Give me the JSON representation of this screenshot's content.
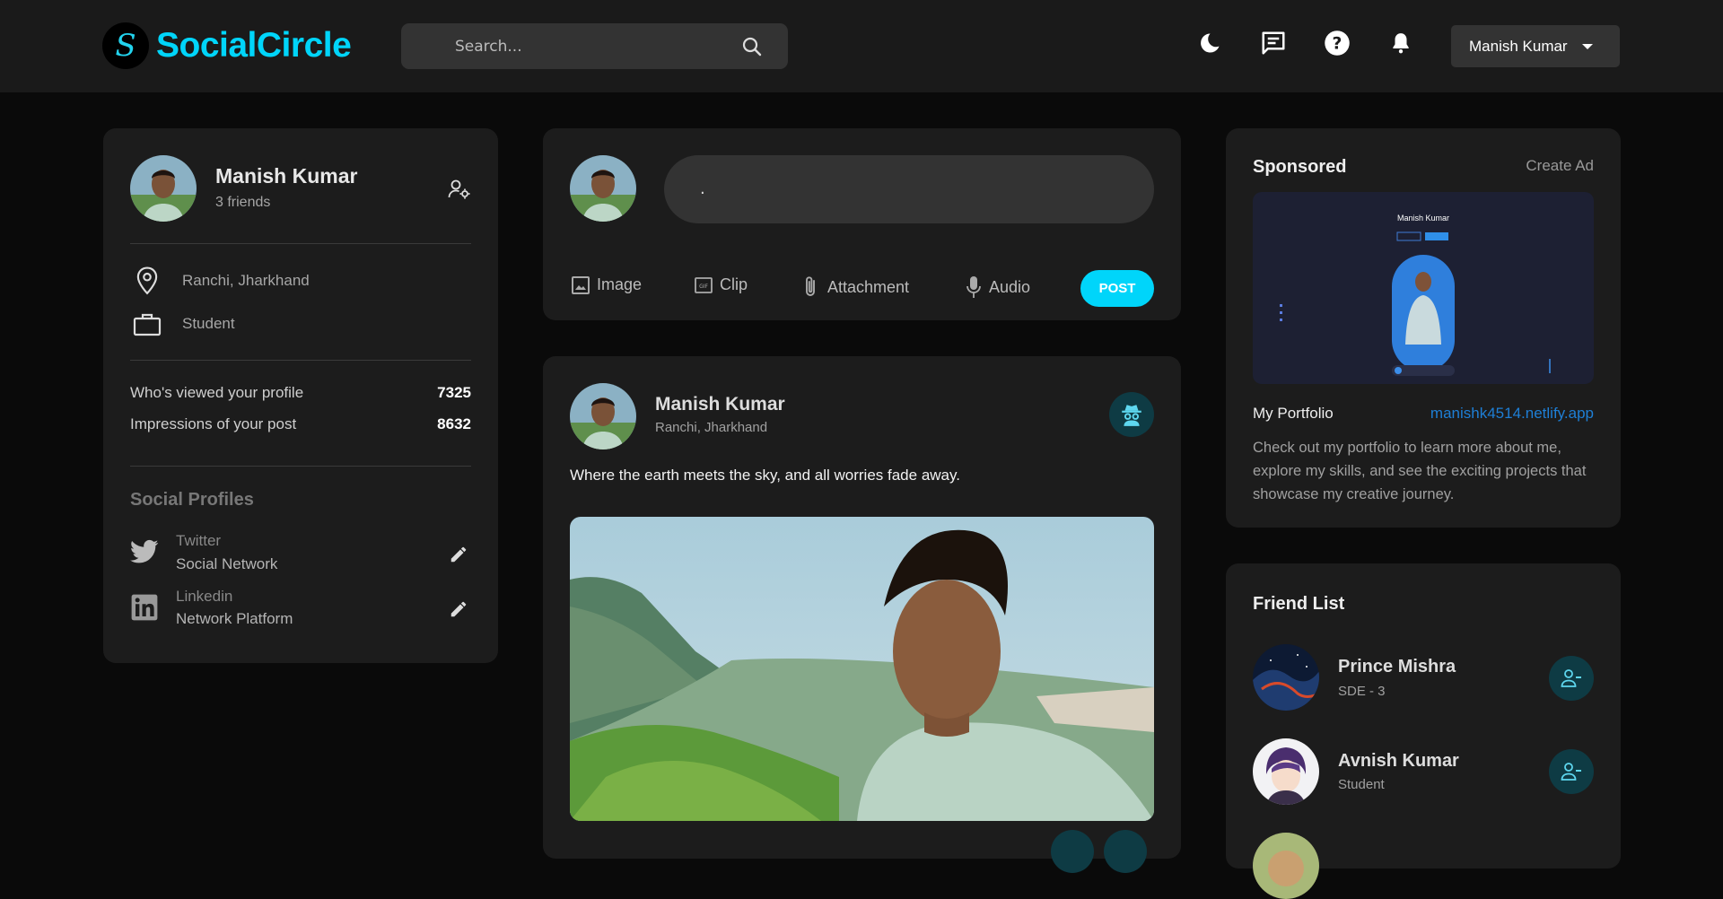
{
  "app": {
    "brand": "SocialCircle",
    "logo_letter": "S",
    "accent": "#00d5fa"
  },
  "navbar": {
    "search_placeholder": "Search...",
    "icons": [
      "moon-icon",
      "message-icon",
      "help-icon",
      "bell-icon"
    ],
    "user_name": "Manish Kumar"
  },
  "profile": {
    "name": "Manish Kumar",
    "friends": "3 friends",
    "location": "Ranchi, Jharkhand",
    "occupation": "Student",
    "stats": [
      {
        "label": "Who's viewed your profile",
        "value": "7325"
      },
      {
        "label": "Impressions of your post",
        "value": "8632"
      }
    ],
    "social_title": "Social Profiles",
    "social": [
      {
        "name": "Twitter",
        "sub": "Social Network",
        "icon": "twitter-icon"
      },
      {
        "name": "Linkedin",
        "sub": "Network Platform",
        "icon": "linkedin-icon"
      }
    ]
  },
  "composer": {
    "value": ".",
    "actions": [
      {
        "label": "Image",
        "icon": "image-icon"
      },
      {
        "label": "Clip",
        "icon": "gif-icon"
      },
      {
        "label": "Attachment",
        "icon": "paperclip-icon"
      },
      {
        "label": "Audio",
        "icon": "microphone-icon"
      }
    ],
    "post_label": "POST"
  },
  "post": {
    "author": "Manish Kumar",
    "location": "Ranchi, Jharkhand",
    "text": "Where the earth meets the sky, and all worries fade away."
  },
  "sponsored": {
    "title": "Sponsored",
    "create_ad": "Create Ad",
    "name": "My Portfolio",
    "link": "manishk4514.netlify.app",
    "description": "Check out my portfolio to learn more about me, explore my skills, and see the exciting projects that showcase my creative journey.",
    "preview_title": "Manish Kumar"
  },
  "friend_list": {
    "title": "Friend List",
    "friends": [
      {
        "name": "Prince Mishra",
        "role": "SDE - 3"
      },
      {
        "name": "Avnish Kumar",
        "role": "Student"
      }
    ]
  }
}
